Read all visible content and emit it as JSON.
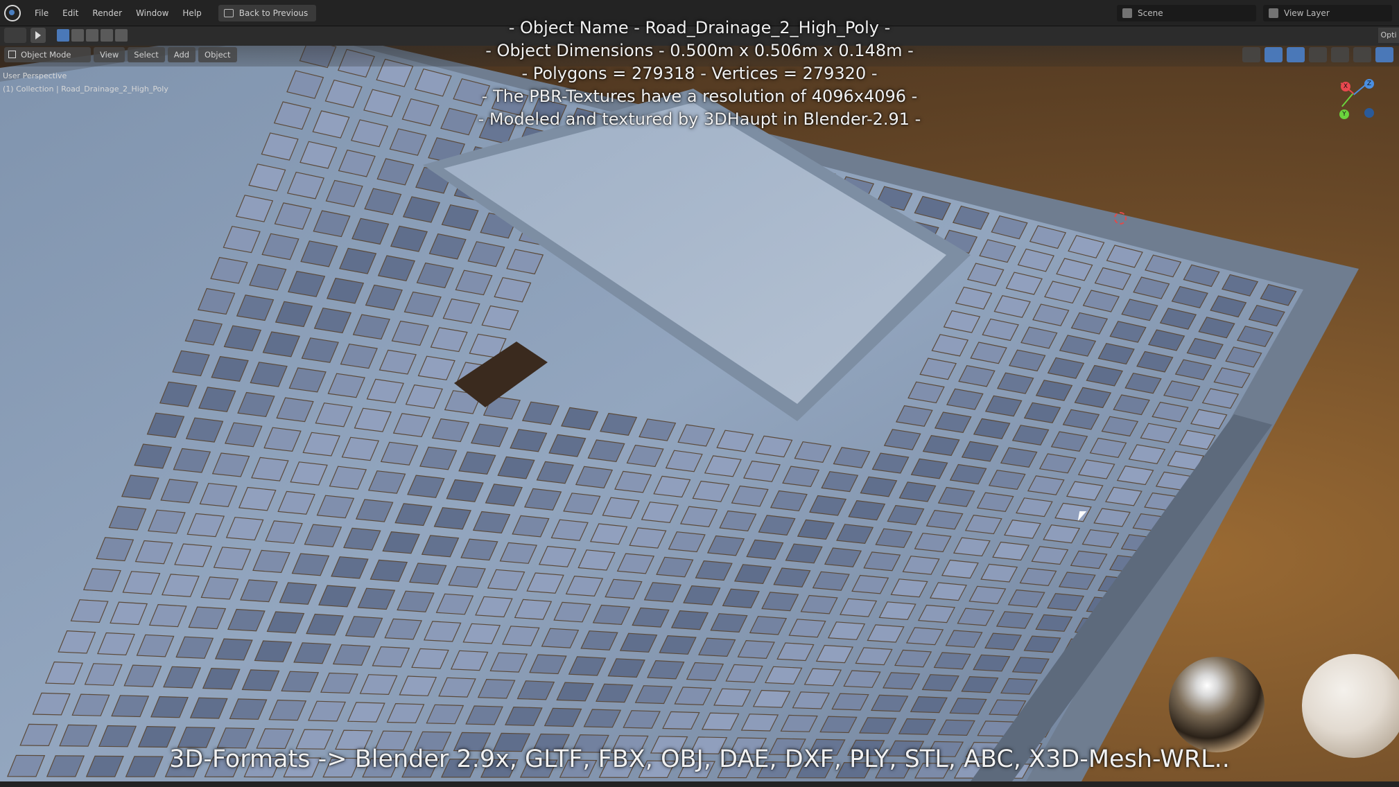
{
  "topbar": {
    "menus": [
      "File",
      "Edit",
      "Render",
      "Window",
      "Help"
    ],
    "back_button": "Back to Previous",
    "scene": "Scene",
    "view_layer": "View Layer"
  },
  "viewport_header": {
    "mode": "Object Mode",
    "menus": [
      "View",
      "Select",
      "Add",
      "Object"
    ],
    "options": "Opti"
  },
  "viewport_info": {
    "perspective": "User Perspective",
    "collection": "(1) Collection | Road_Drainage_2_High_Poly"
  },
  "overlay": {
    "lines": [
      "- Object Name - Road_Drainage_2_High_Poly -",
      "- Object Dimensions -  0.500m x 0.506m x 0.148m -",
      "- Polygons = 279318  -  Vertices = 279320 -",
      "- The PBR-Textures have a resolution of 4096x4096 -",
      "- Modeled and textured by 3DHaupt in Blender-2.91 -"
    ],
    "formats": "3D-Formats -> Blender 2.9x, GLTF, FBX, OBJ, DAE, DXF, PLY, STL, ABC, X3D-Mesh-WRL.."
  },
  "gizmo": {
    "x_label": "X",
    "y_label": "Y",
    "z_label": "Z"
  },
  "colors": {
    "plate": "#8da0b8",
    "background_warm": "#9a6a33",
    "accent_blue": "#4a78b8"
  }
}
